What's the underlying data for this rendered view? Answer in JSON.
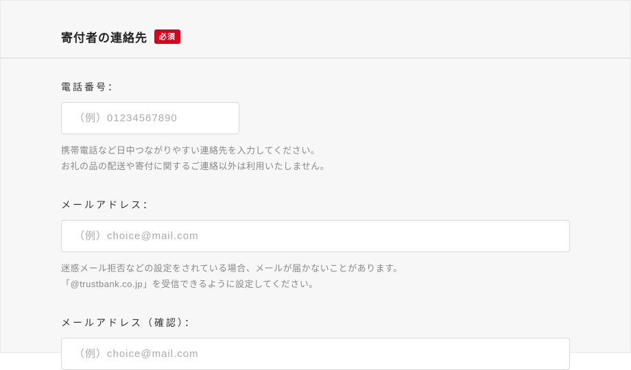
{
  "section": {
    "title": "寄付者の連絡先",
    "required_badge": "必須"
  },
  "fields": {
    "phone": {
      "label": "電話番号：",
      "placeholder": "（例）01234567890",
      "help_line1": "携帯電話など日中つながりやすい連絡先を入力してください。",
      "help_line2": "お礼の品の配送や寄付に関するご連絡以外は利用いたしません。"
    },
    "email": {
      "label": "メールアドレス：",
      "placeholder": "（例）choice@mail.com",
      "help_line1": "迷惑メール拒否などの設定をされている場合、メールが届かないことがあります。",
      "help_line2": "「@trustbank.co.jp」を受信できるように設定してください。"
    },
    "email_confirm": {
      "label": "メールアドレス（確認）：",
      "placeholder": "（例）choice@mail.com"
    }
  }
}
